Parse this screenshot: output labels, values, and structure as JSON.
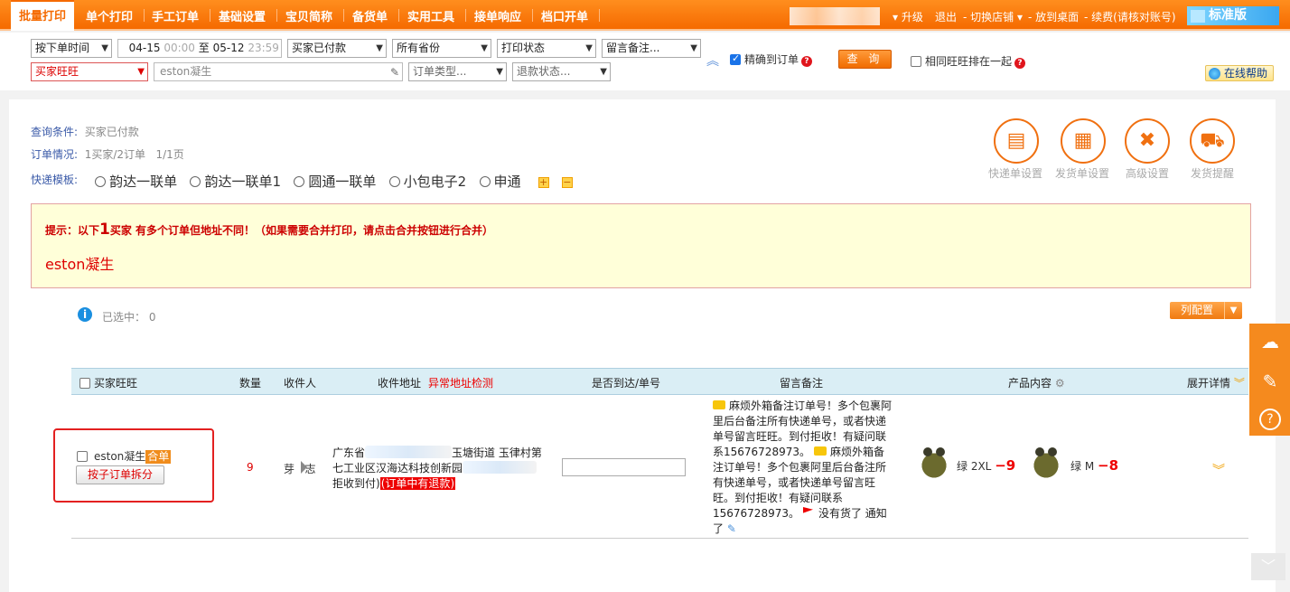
{
  "nav": {
    "active": "批量打印",
    "items": [
      "单个打印",
      "手工订单",
      "基础设置",
      "宝贝简称",
      "备货单",
      "实用工具",
      "接单响应",
      "档口开单"
    ],
    "right": {
      "upgrade": "升级",
      "logout": "退出",
      "switch_shop": "切换店铺",
      "desktop": "放到桌面",
      "renew": "续费(请核对账号)",
      "edition": "标准版"
    }
  },
  "filters": {
    "sort": "按下单时间",
    "date_from": "04-15",
    "time_from": "00:00",
    "date_to_sep": "至",
    "date_to": "05-12",
    "time_to": "23:59",
    "status": "买家已付款",
    "province": "所有省份",
    "print_status": "打印状态",
    "remark": "留言备注...",
    "buyer_field": "买家旺旺",
    "buyer_value": "eston凝生",
    "order_type": "订单类型...",
    "refund_status": "退款状态...",
    "exact_label": "精确到订单",
    "query_btn": "查 询",
    "same_buyer_label": "相同旺旺排在一起",
    "help_btn": "在线帮助"
  },
  "summary": {
    "cond_label": "查询条件:",
    "cond_value": "买家已付款",
    "order_label": "订单情况:",
    "order_value": "1买家/2订单",
    "page_value": "1/1页",
    "template_label": "快递模板:",
    "templates": [
      "韵达一联单",
      "韵达一联单1",
      "圆通一联单",
      "小包电子2",
      "申通"
    ],
    "tools": [
      "快递单设置",
      "发货单设置",
      "高级设置",
      "发货提醒"
    ]
  },
  "tip": {
    "prefix": "提示：以下",
    "count": "1",
    "suffix": "买家 有多个订单但地址不同！（如果需要合并打印，请点击合并按钮进行合并）",
    "buyer": "eston凝生"
  },
  "selection": {
    "label": "已选中：",
    "count": "0",
    "col_config": "列配置"
  },
  "table": {
    "headers": {
      "buyer": "买家旺旺",
      "qty": "数量",
      "receiver": "收件人",
      "address": "收件地址",
      "address_check": "异常地址检测",
      "reach": "是否到达/单号",
      "remark": "留言备注",
      "product": "产品内容",
      "expand": "展开详情"
    },
    "row": {
      "buyer": "eston凝生",
      "merge_tag": "合单",
      "split_btn": "按子订单拆分",
      "qty": "9",
      "receiver": "芽   志",
      "address_line1": "广东省",
      "address_mid": "玉塘街道 玉律村第",
      "address_line2": "七工业区汉海达科技创新园",
      "address_line3": "拒收到付)",
      "refund_tag": "(订单中有退款)",
      "note": "麻烦外箱备注订单号！多个包裹阿里后台备注所有快递单号，或者快递单号留言旺旺。到付拒收！有疑问联系15676728973。",
      "note2": "麻烦外箱备注订单号！多个包裹阿里后台备注所有快递单号，或者快递单号留言旺旺。到付拒收！有疑问联系15676728973。",
      "note3": "没有货了 通知了",
      "products": [
        {
          "spec": "绿 2XL",
          "qty": "−9"
        },
        {
          "spec": "绿 M",
          "qty": "−8"
        }
      ]
    }
  }
}
